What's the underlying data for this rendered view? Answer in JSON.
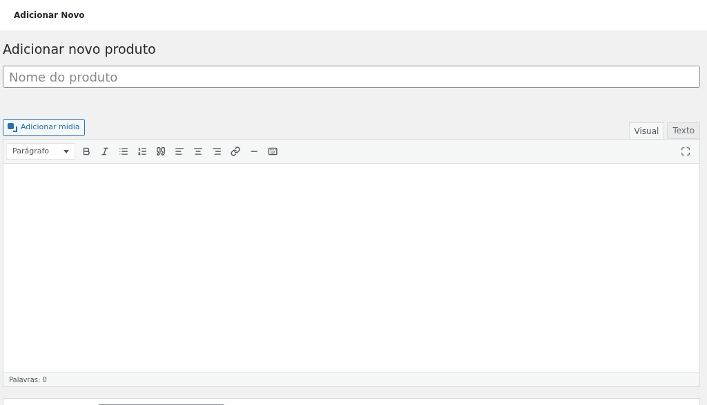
{
  "header": {
    "title": "Adicionar Novo"
  },
  "page_title": "Adicionar novo produto",
  "product_name": {
    "placeholder": "Nome do produto"
  },
  "media_button": "Adicionar mídia",
  "editor_tabs": [
    {
      "label": "Visual",
      "selected": true
    },
    {
      "label": "Texto",
      "selected": false
    }
  ],
  "format_select": {
    "value": "Parágrafo"
  },
  "status_bar": "Palavras: 0"
}
